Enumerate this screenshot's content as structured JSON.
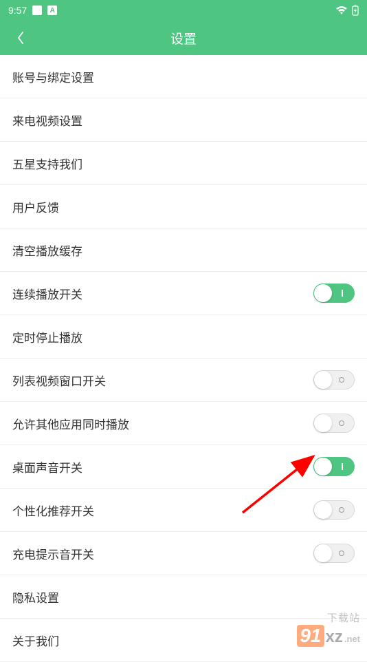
{
  "statusBar": {
    "time": "9:57",
    "iconA": "A"
  },
  "header": {
    "title": "设置"
  },
  "settings": [
    {
      "label": "账号与绑定设置",
      "type": "nav"
    },
    {
      "label": "来电视频设置",
      "type": "nav"
    },
    {
      "label": "五星支持我们",
      "type": "nav"
    },
    {
      "label": "用户反馈",
      "type": "nav"
    },
    {
      "label": "清空播放缓存",
      "type": "nav"
    },
    {
      "label": "连续播放开关",
      "type": "toggle",
      "value": true
    },
    {
      "label": "定时停止播放",
      "type": "nav"
    },
    {
      "label": "列表视频窗口开关",
      "type": "toggle",
      "value": false
    },
    {
      "label": "允许其他应用同时播放",
      "type": "toggle",
      "value": false
    },
    {
      "label": "桌面声音开关",
      "type": "toggle",
      "value": true
    },
    {
      "label": "个性化推荐开关",
      "type": "toggle",
      "value": false
    },
    {
      "label": "充电提示音开关",
      "type": "toggle",
      "value": false
    },
    {
      "label": "隐私设置",
      "type": "nav"
    },
    {
      "label": "关于我们",
      "type": "nav"
    }
  ],
  "watermark": {
    "brand_top": "下载站",
    "brand_main": "91",
    "brand_sub": "xz",
    "brand_domain": ".net"
  },
  "colors": {
    "accent": "#4ec580",
    "arrow": "#ff0000"
  }
}
